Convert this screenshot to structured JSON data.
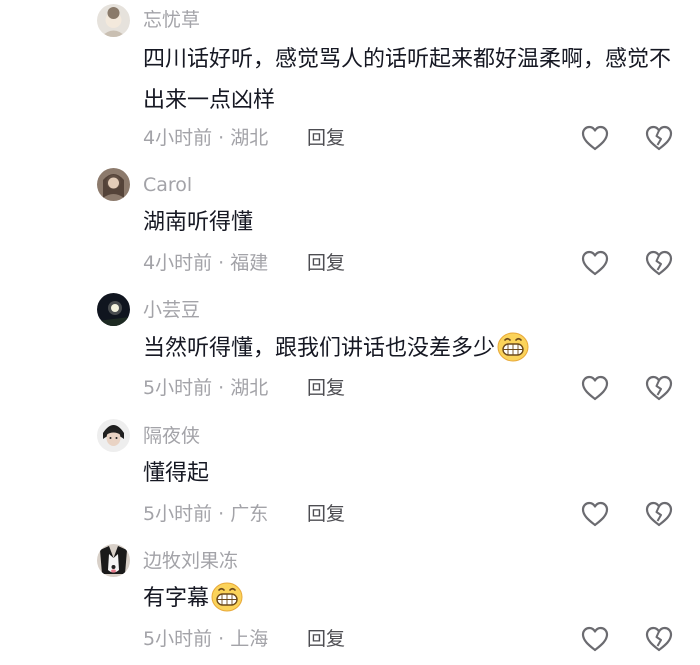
{
  "comments": [
    {
      "username": "忘忧草",
      "text": "四川话好听，感觉骂人的话听起来都好温柔啊，感觉不出来一点凶样",
      "meta": "4小时前 · 湖北",
      "reply_label": "回复",
      "emoji": null
    },
    {
      "username": "Carol",
      "text": "湖南听得懂",
      "meta": "4小时前 · 福建",
      "reply_label": "回复",
      "emoji": null
    },
    {
      "username": "小芸豆",
      "text": "当然听得懂，跟我们讲话也没差多少",
      "meta": "5小时前 · 湖北",
      "reply_label": "回复",
      "emoji": "grinning-face-emoji"
    },
    {
      "username": "隔夜侠",
      "text": "懂得起",
      "meta": "5小时前 · 广东",
      "reply_label": "回复",
      "emoji": null
    },
    {
      "username": "边牧刘果冻",
      "text": "有字幕",
      "meta": "5小时前 · 上海",
      "reply_label": "回复",
      "emoji": "grinning-face-emoji"
    }
  ],
  "icons": {
    "like": "heart-outline-icon",
    "dislike": "broken-heart-outline-icon"
  },
  "colors": {
    "text": "#161823",
    "secondary": "#a3a3a8",
    "reply": "#4d4d52",
    "icon": "#6b6b70"
  }
}
